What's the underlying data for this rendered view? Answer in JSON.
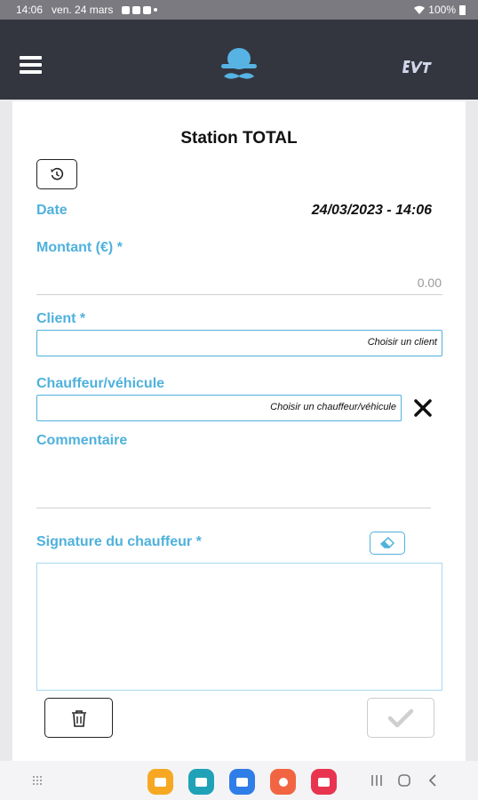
{
  "status_bar": {
    "time": "14:06",
    "date": "ven. 24 mars",
    "battery": "100%"
  },
  "header": {
    "menu_icon": "hamburger-icon",
    "logo": "bowler-hat-mustache-logo",
    "brand_badge": "brand-logo-icon"
  },
  "form": {
    "title": "Station TOTAL",
    "history_icon": "history-icon",
    "date_label": "Date",
    "date_value": "24/03/2023 - 14:06",
    "amount_label": "Montant (€) *",
    "amount_value": "0.00",
    "client_label": "Client *",
    "client_placeholder": "Choisir un client",
    "driver_label": "Chauffeur/véhicule",
    "driver_placeholder": "Choisir un chauffeur/véhicule",
    "clear_icon": "close-icon",
    "comment_label": "Commentaire",
    "signature_label": "Signature du chauffeur *",
    "eraser_icon": "eraser-icon",
    "delete_icon": "trash-icon",
    "confirm_icon": "checkmark-icon"
  },
  "nav_bar": {
    "apps": [
      {
        "name": "files-app",
        "color": "#f7a823"
      },
      {
        "name": "calendar-app",
        "color": "#1fa2b8"
      },
      {
        "name": "messages-app",
        "color": "#2f7de6"
      },
      {
        "name": "contacts-app",
        "color": "#f26542"
      },
      {
        "name": "screen-recorder-app",
        "color": "#e8344f"
      }
    ]
  },
  "colors": {
    "accent": "#4fb1dc",
    "header_bg": "#33363f",
    "status_bar_bg": "#7a7a80"
  }
}
